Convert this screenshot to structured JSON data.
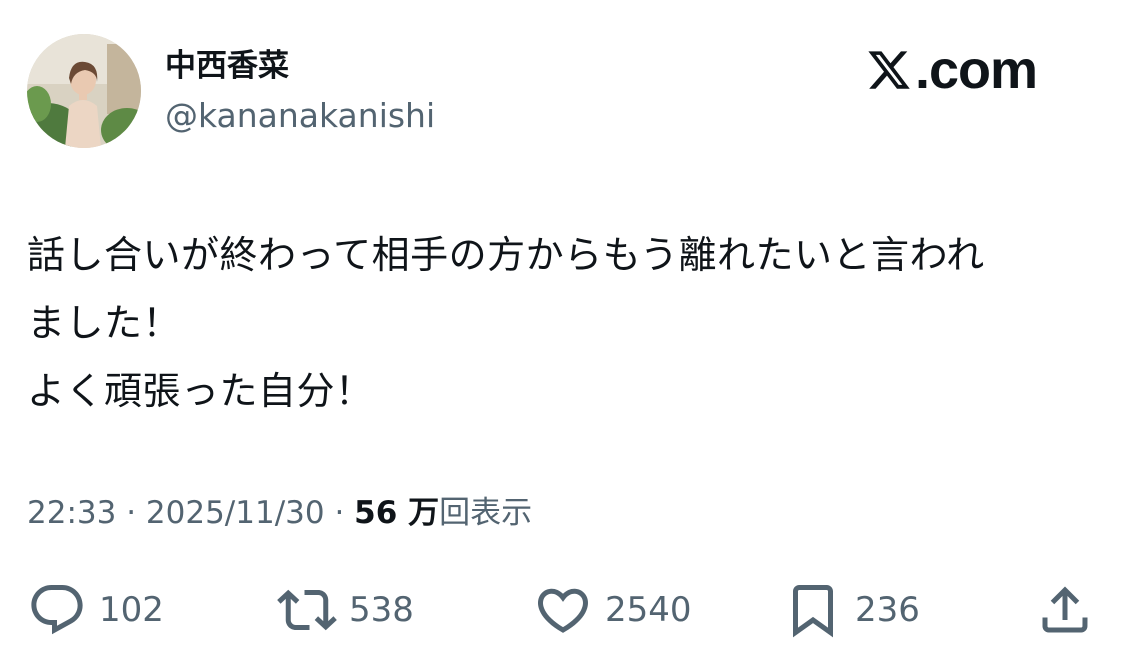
{
  "author": {
    "display_name": "中西香菜",
    "handle": "@kananakanishi"
  },
  "brand": {
    "text": ".com",
    "icon": "x-logo-icon"
  },
  "tweet": {
    "lines": [
      "話し合いが終わって相手の方からもう離れたいと言われ",
      "ました！",
      "よく頑張った自分！"
    ]
  },
  "meta": {
    "time": "22:33",
    "separator": " · ",
    "date": "2025/11/30",
    "views_number": "56 万",
    "views_label": "回表示"
  },
  "actions": {
    "reply": {
      "icon": "reply-icon",
      "count": "102"
    },
    "retweet": {
      "icon": "retweet-icon",
      "count": "538"
    },
    "like": {
      "icon": "heart-icon",
      "count": "2540"
    },
    "bookmark": {
      "icon": "bookmark-icon",
      "count": "236"
    },
    "share": {
      "icon": "share-icon"
    }
  },
  "colors": {
    "text_primary": "#0f1419",
    "text_secondary": "#536471",
    "icon": "#536471"
  }
}
